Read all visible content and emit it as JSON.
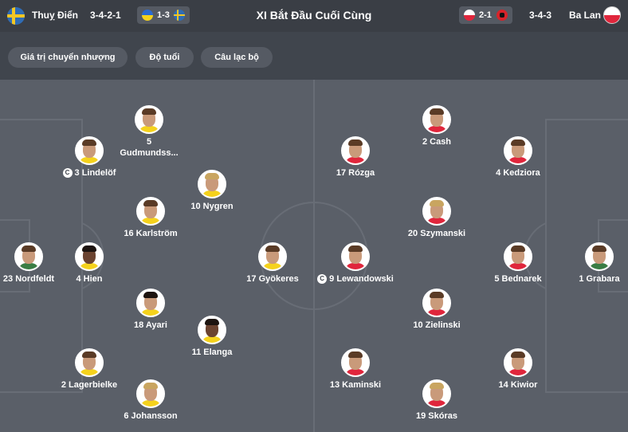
{
  "header": {
    "home_team": "Thuỵ Điển",
    "home_formation": "3-4-2-1",
    "home_last_score": "1-3",
    "title": "XI Bắt Đầu Cuối Cùng",
    "away_last_score": "2-1",
    "away_formation": "3-4-3",
    "away_team": "Ba Lan"
  },
  "filters": [
    "Giá trị chuyển nhượng",
    "Độ tuổi",
    "Câu lạc bộ"
  ],
  "captain_badge": "C",
  "home_players": [
    {
      "label": "5",
      "label2": "Gudmundss..."
    },
    {
      "label": "3 Lindelöf",
      "captain": true
    },
    {
      "label": "10 Nygren"
    },
    {
      "label": "16 Karlström"
    },
    {
      "label": "23 Nordfeldt"
    },
    {
      "label": "4 Hien"
    },
    {
      "label": "17 Gyökeres"
    },
    {
      "label": "18 Ayari"
    },
    {
      "label": "11 Elanga"
    },
    {
      "label": "2 Lagerbielke"
    },
    {
      "label": "6 Johansson"
    }
  ],
  "away_players": [
    {
      "label": "2 Cash"
    },
    {
      "label": "17 Rózga"
    },
    {
      "label": "4 Kedziora"
    },
    {
      "label": "20 Szymanski"
    },
    {
      "label": "9 Lewandowski",
      "captain": true
    },
    {
      "label": "5 Bednarek"
    },
    {
      "label": "1 Grabara"
    },
    {
      "label": "10 Zielinski"
    },
    {
      "label": "13 Kaminski"
    },
    {
      "label": "14 Kiwior"
    },
    {
      "label": "19 Skóras"
    }
  ]
}
